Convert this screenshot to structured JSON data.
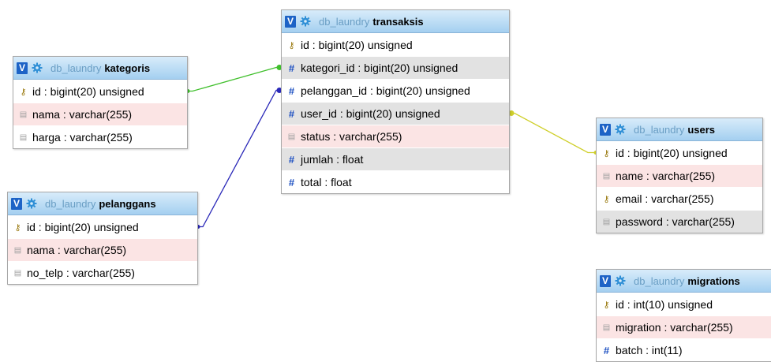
{
  "links": [
    {
      "from": "kategoris.id",
      "to": "transaksis.kategori_id",
      "color": "#3fbf2b"
    },
    {
      "from": "pelanggans.id",
      "to": "transaksis.pelanggan_id",
      "color": "#2a28b8"
    },
    {
      "from": "users.id",
      "to": "transaksis.user_id",
      "color": "#cfcf2a"
    }
  ],
  "tables": [
    {
      "id": "kategoris",
      "db": "db_laundry",
      "name": "kategoris",
      "toggle": "V",
      "columns": [
        {
          "key": "id",
          "type": ": bigint(20) unsigned",
          "icon": "key-icon"
        },
        {
          "key": "nama",
          "type": ": varchar(255)",
          "icon": "string-icon"
        },
        {
          "key": "harga",
          "type": ": varchar(255)",
          "icon": "string-icon"
        }
      ]
    },
    {
      "id": "pelanggans",
      "db": "db_laundry",
      "name": "pelanggans",
      "toggle": "V",
      "columns": [
        {
          "key": "id",
          "type": ": bigint(20) unsigned",
          "icon": "key-icon"
        },
        {
          "key": "nama",
          "type": ": varchar(255)",
          "icon": "string-icon"
        },
        {
          "key": "no_telp",
          "type": ": varchar(255)",
          "icon": "string-icon"
        }
      ]
    },
    {
      "id": "transaksis",
      "db": "db_laundry",
      "name": "transaksis",
      "toggle": "V",
      "columns": [
        {
          "key": "id",
          "type": ": bigint(20) unsigned",
          "icon": "key-icon"
        },
        {
          "key": "kategori_id",
          "type": ": bigint(20) unsigned",
          "icon": "numeric-icon"
        },
        {
          "key": "pelanggan_id",
          "type": ": bigint(20) unsigned",
          "icon": "numeric-icon"
        },
        {
          "key": "user_id",
          "type": ": bigint(20) unsigned",
          "icon": "numeric-icon"
        },
        {
          "key": "status",
          "type": ": varchar(255)",
          "icon": "string-icon"
        },
        {
          "key": "jumlah",
          "type": ": float",
          "icon": "numeric-icon"
        },
        {
          "key": "total",
          "type": ": float",
          "icon": "numeric-icon"
        }
      ]
    },
    {
      "id": "users",
      "db": "db_laundry",
      "name": "users",
      "toggle": "V",
      "columns": [
        {
          "key": "id",
          "type": ": bigint(20) unsigned",
          "icon": "key-icon"
        },
        {
          "key": "name",
          "type": ": varchar(255)",
          "icon": "string-icon"
        },
        {
          "key": "email",
          "type": ": varchar(255)",
          "icon": "key-icon"
        },
        {
          "key": "password",
          "type": ": varchar(255)",
          "icon": "string-icon"
        }
      ]
    },
    {
      "id": "migrations",
      "db": "db_laundry",
      "name": "migrations",
      "toggle": "V",
      "columns": [
        {
          "key": "id",
          "type": ": int(10) unsigned",
          "icon": "key-icon"
        },
        {
          "key": "migration",
          "type": ": varchar(255)",
          "icon": "string-icon"
        },
        {
          "key": "batch",
          "type": ": int(11)",
          "icon": "numeric-icon"
        }
      ]
    }
  ]
}
